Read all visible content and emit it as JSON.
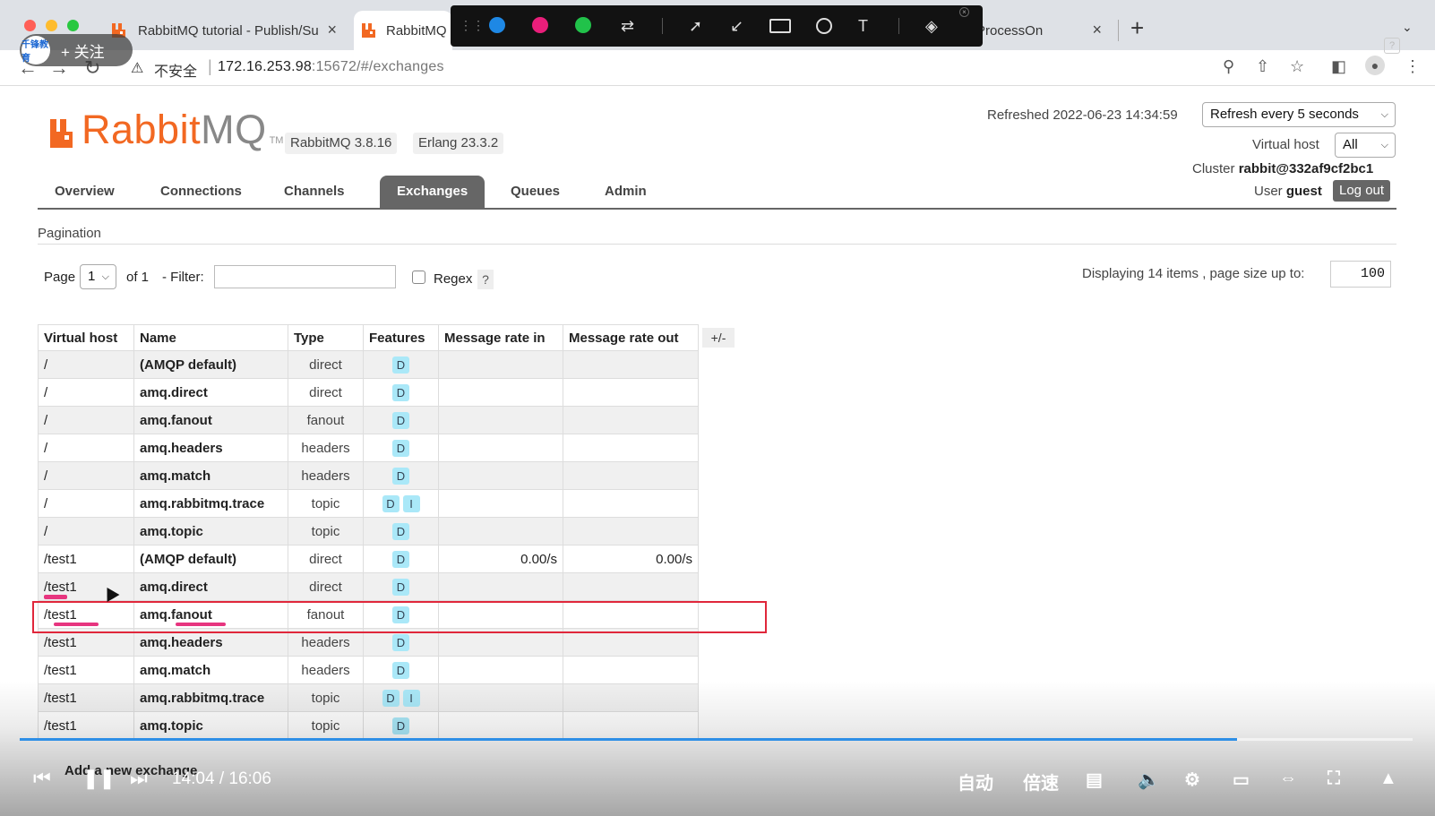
{
  "browser": {
    "tabs": [
      {
        "title": "RabbitMQ tutorial - Publish/Su",
        "close": "×"
      },
      {
        "title": "RabbitMQ"
      },
      {
        "title": "ProcessOn",
        "close": "×"
      }
    ],
    "new_tab": "+",
    "address": {
      "insecure_label": "不安全",
      "host": "172.16.253.98",
      "rest": ":15672/#/exchanges"
    }
  },
  "follow_badge": {
    "avatar_text": "千锋教育",
    "label": "+ 关注"
  },
  "annotation_toolbar": {
    "colors": [
      "#1e88e5",
      "#e91e7a",
      "#21c24a"
    ],
    "tools": [
      "shuffle-icon",
      "line-icon",
      "arrow-icon",
      "rectangle-icon",
      "circle-icon",
      "text-icon",
      "eraser-icon"
    ],
    "text_tool": "T"
  },
  "rabbitmq": {
    "logo_word_rabbit": "Rabbit",
    "logo_word_mq": "MQ",
    "logo_tm": "TM",
    "version": "RabbitMQ 3.8.16",
    "erlang": "Erlang 23.3.2",
    "refreshed": "Refreshed 2022-06-23 14:34:59",
    "refresh_select": "Refresh every 5 seconds",
    "vhost_label": "Virtual host",
    "vhost_select": "All",
    "cluster_label": "Cluster",
    "cluster_name": "rabbit@332af9cf2bc1",
    "user_label": "User",
    "user_name": "guest",
    "logout": "Log out",
    "nav": [
      "Overview",
      "Connections",
      "Channels",
      "Exchanges",
      "Queues",
      "Admin"
    ],
    "active_nav": "Exchanges",
    "pagination_title": "Pagination",
    "page_label": "Page",
    "page_value": "1",
    "of_label": "of 1",
    "filter_label": "- Filter:",
    "regex_label": "Regex",
    "help": "?",
    "displaying": "Displaying 14 items , page size up to:",
    "page_size": "100",
    "columns": [
      "Virtual host",
      "Name",
      "Type",
      "Features",
      "Message rate in",
      "Message rate out"
    ],
    "plus_minus": "+/-",
    "rows": [
      {
        "vhost": "/",
        "name": "(AMQP default)",
        "type": "direct",
        "features": [
          "D"
        ],
        "rate_in": "",
        "rate_out": ""
      },
      {
        "vhost": "/",
        "name": "amq.direct",
        "type": "direct",
        "features": [
          "D"
        ],
        "rate_in": "",
        "rate_out": ""
      },
      {
        "vhost": "/",
        "name": "amq.fanout",
        "type": "fanout",
        "features": [
          "D"
        ],
        "rate_in": "",
        "rate_out": ""
      },
      {
        "vhost": "/",
        "name": "amq.headers",
        "type": "headers",
        "features": [
          "D"
        ],
        "rate_in": "",
        "rate_out": ""
      },
      {
        "vhost": "/",
        "name": "amq.match",
        "type": "headers",
        "features": [
          "D"
        ],
        "rate_in": "",
        "rate_out": ""
      },
      {
        "vhost": "/",
        "name": "amq.rabbitmq.trace",
        "type": "topic",
        "features": [
          "D",
          "I"
        ],
        "rate_in": "",
        "rate_out": ""
      },
      {
        "vhost": "/",
        "name": "amq.topic",
        "type": "topic",
        "features": [
          "D"
        ],
        "rate_in": "",
        "rate_out": ""
      },
      {
        "vhost": "/test1",
        "name": "(AMQP default)",
        "type": "direct",
        "features": [
          "D"
        ],
        "rate_in": "0.00/s",
        "rate_out": "0.00/s"
      },
      {
        "vhost": "/test1",
        "name": "amq.direct",
        "type": "direct",
        "features": [
          "D"
        ],
        "rate_in": "",
        "rate_out": ""
      },
      {
        "vhost": "/test1",
        "name": "amq.fanout",
        "type": "fanout",
        "features": [
          "D"
        ],
        "rate_in": "",
        "rate_out": ""
      },
      {
        "vhost": "/test1",
        "name": "amq.headers",
        "type": "headers",
        "features": [
          "D"
        ],
        "rate_in": "",
        "rate_out": ""
      },
      {
        "vhost": "/test1",
        "name": "amq.match",
        "type": "headers",
        "features": [
          "D"
        ],
        "rate_in": "",
        "rate_out": ""
      },
      {
        "vhost": "/test1",
        "name": "amq.rabbitmq.trace",
        "type": "topic",
        "features": [
          "D",
          "I"
        ],
        "rate_in": "",
        "rate_out": ""
      },
      {
        "vhost": "/test1",
        "name": "amq.topic",
        "type": "topic",
        "features": [
          "D"
        ],
        "rate_in": "",
        "rate_out": ""
      }
    ],
    "add_exchange": "Add a new exchange"
  },
  "player": {
    "current_time": "14:04",
    "separator": "/",
    "duration": "16:06",
    "progress_fraction": 0.874,
    "controls": {
      "auto": "自动",
      "speed": "倍速"
    },
    "accent": "#2e8fe6"
  }
}
